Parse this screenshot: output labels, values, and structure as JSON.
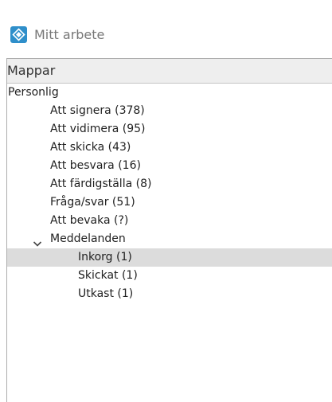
{
  "window": {
    "title": "Mitt arbete",
    "icon": "app-logo-icon",
    "accent_color": "#2f8fca"
  },
  "panel": {
    "header": "Mappar"
  },
  "tree": {
    "root": "Personlig",
    "items": [
      "Att signera (378)",
      "Att vidimera (95)",
      "Att skicka (43)",
      "Att besvara (16)",
      "Att färdigställa (8)",
      "Fråga/svar (51)",
      "Att bevaka (?)"
    ],
    "group": {
      "label": "Meddelanden",
      "expanded": true,
      "children": [
        {
          "label": "Inkorg (1)",
          "selected": true
        },
        {
          "label": "Skickat (1)",
          "selected": false
        },
        {
          "label": "Utkast (1)",
          "selected": false
        }
      ]
    }
  }
}
